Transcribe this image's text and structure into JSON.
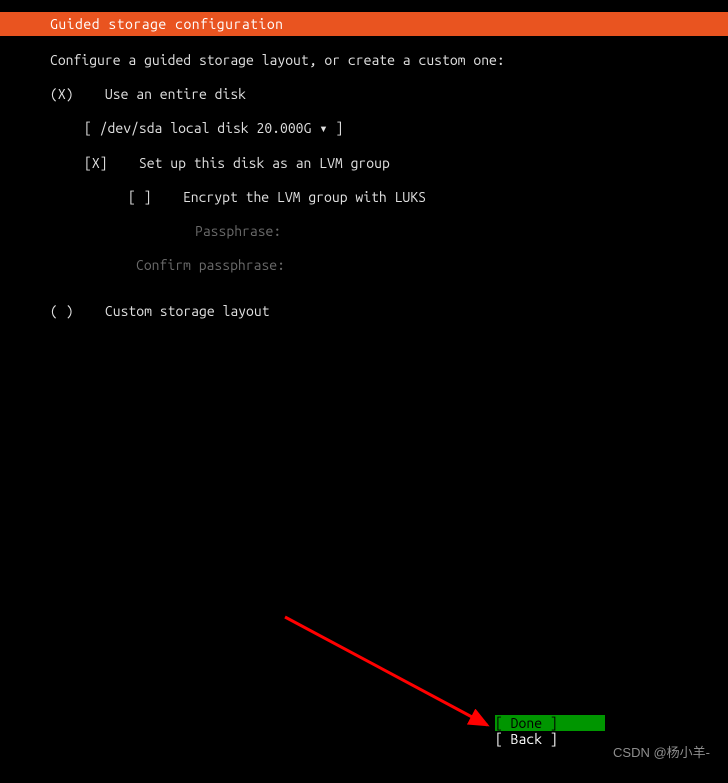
{
  "header": {
    "title": "Guided storage configuration"
  },
  "instruction": "Configure a guided storage layout, or create a custom one:",
  "options": {
    "entire_disk": {
      "marker": "(X)",
      "label": "Use an entire disk",
      "disk_selector": "[ /dev/sda local disk 20.000G ▾ ]",
      "lvm": {
        "marker": "[X]",
        "label": "Set up this disk as an LVM group"
      },
      "encrypt": {
        "marker": "[ ]",
        "label": "Encrypt the LVM group with LUKS",
        "passphrase_label": "Passphrase:",
        "confirm_label": "Confirm passphrase:"
      }
    },
    "custom": {
      "marker": "( )",
      "label": "Custom storage layout"
    }
  },
  "buttons": {
    "done": "[ Done           ]",
    "back": "[ Back           ]"
  },
  "watermark": "CSDN @杨小羊-"
}
